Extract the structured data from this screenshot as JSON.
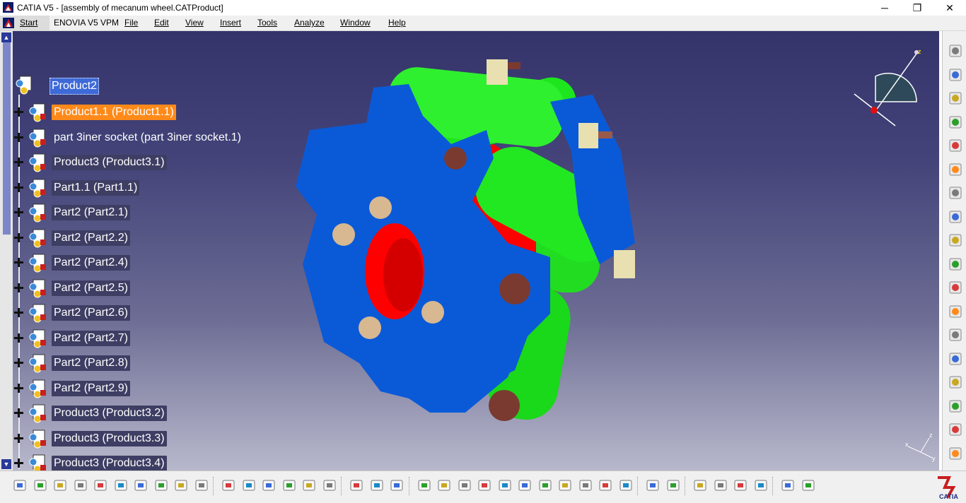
{
  "window": {
    "title": "CATIA V5 - [assembly of mecanum wheel.CATProduct]",
    "min_glyph": "─",
    "max_glyph": "❐",
    "close_glyph": "✕"
  },
  "menu": {
    "start": "Start",
    "items": [
      "ENOVIA V5 VPM",
      "File",
      "Edit",
      "View",
      "Insert",
      "Tools",
      "Analyze",
      "Window",
      "Help"
    ]
  },
  "mdi": {
    "min": "_",
    "restore": "❐",
    "close": "✕"
  },
  "tree": {
    "root": "Product2",
    "nodes": [
      {
        "label": "Product1.1 (Product1.1)",
        "style": "selected"
      },
      {
        "label": "part 3iner socket (part 3iner socket.1)",
        "style": "plain"
      },
      {
        "label": "Product3 (Product3.1)",
        "style": "normal"
      },
      {
        "label": "Part1.1 (Part1.1)",
        "style": "normal"
      },
      {
        "label": "Part2 (Part2.1)",
        "style": "normal"
      },
      {
        "label": "Part2 (Part2.2)",
        "style": "normal"
      },
      {
        "label": "Part2 (Part2.4)",
        "style": "normal"
      },
      {
        "label": "Part2 (Part2.5)",
        "style": "normal"
      },
      {
        "label": "Part2 (Part2.6)",
        "style": "normal"
      },
      {
        "label": "Part2 (Part2.7)",
        "style": "normal"
      },
      {
        "label": "Part2 (Part2.8)",
        "style": "normal"
      },
      {
        "label": "Part2 (Part2.9)",
        "style": "normal"
      },
      {
        "label": "Product3 (Product3.2)",
        "style": "normal"
      },
      {
        "label": "Product3 (Product3.3)",
        "style": "normal"
      },
      {
        "label": "Product3 (Product3.4)",
        "style": "normal"
      }
    ]
  },
  "compass": {
    "z_label": "z"
  },
  "axes": {
    "z": "z",
    "y": "y",
    "x": "x"
  },
  "colors": {
    "hub_red": "#ff0000",
    "frame_blue": "#0a5ad8",
    "roller_green": "#1ee61e",
    "nut_tan": "#d8b890",
    "bolt_brown": "#7a3a30",
    "selection_orange": "#ff8a1a"
  },
  "right_toolbar": [
    {
      "name": "gear-icon"
    },
    {
      "name": "part-design-icon"
    },
    {
      "name": "assembly-icon"
    },
    {
      "name": "product-icon"
    },
    {
      "name": "component-icon"
    },
    {
      "name": "select-arrow-icon"
    },
    {
      "name": "manipulation-icon"
    },
    {
      "name": "constraint-icon"
    },
    {
      "name": "fix-icon"
    },
    {
      "name": "coincidence-icon"
    },
    {
      "name": "export-icon"
    },
    {
      "name": "import-icon"
    },
    {
      "name": "explode-icon"
    },
    {
      "name": "reorder-icon"
    },
    {
      "name": "annotation-icon"
    },
    {
      "name": "catalog-icon"
    },
    {
      "name": "scene-icon"
    },
    {
      "name": "tools-gear-icon"
    }
  ],
  "bottom_toolbar": [
    {
      "name": "new-icon"
    },
    {
      "name": "open-icon"
    },
    {
      "name": "save-icon"
    },
    {
      "name": "print-icon"
    },
    {
      "name": "cut-icon"
    },
    {
      "name": "copy-icon"
    },
    {
      "name": "paste-icon"
    },
    {
      "name": "undo-icon"
    },
    {
      "name": "redo-icon"
    },
    {
      "name": "whats-this-icon"
    },
    {
      "name": "formula-icon"
    },
    {
      "name": "comment-icon"
    },
    {
      "name": "table-icon"
    },
    {
      "name": "tree-icon"
    },
    {
      "name": "lock-icon"
    },
    {
      "name": "hierarchy-icon"
    },
    {
      "name": "fly-icon"
    },
    {
      "name": "fit-all-icon"
    },
    {
      "name": "pan-icon"
    },
    {
      "name": "rotate-icon"
    },
    {
      "name": "zoom-in-icon"
    },
    {
      "name": "zoom-out-icon"
    },
    {
      "name": "normal-view-icon"
    },
    {
      "name": "multi-view-icon"
    },
    {
      "name": "iso-view-icon"
    },
    {
      "name": "shading-icon"
    },
    {
      "name": "hide-show-icon"
    },
    {
      "name": "swap-space-icon"
    },
    {
      "name": "analysis-icon"
    },
    {
      "name": "compare-icon"
    },
    {
      "name": "measure-icon"
    },
    {
      "name": "camera-icon"
    },
    {
      "name": "capture-icon"
    },
    {
      "name": "measure-between-icon"
    },
    {
      "name": "measure-item-icon"
    },
    {
      "name": "mass-icon"
    },
    {
      "name": "update-icon"
    },
    {
      "name": "eraser-icon"
    }
  ]
}
